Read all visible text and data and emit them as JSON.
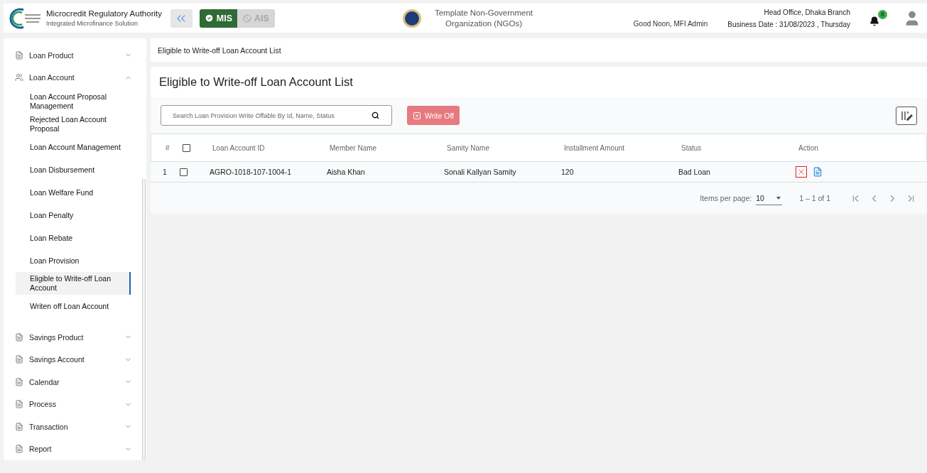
{
  "header": {
    "org_title": "Microcredit Regulatory Authority",
    "org_subtitle": "Integrated Microfinance Solution",
    "modes": [
      {
        "label": "MIS",
        "selected": true
      },
      {
        "label": "AIS",
        "selected": false
      }
    ],
    "center_org": "Template Non-Government Organization (NGOs)",
    "greeting": "Good Noon, MFI Admin",
    "branch": "Head Office, Dhaka Branch",
    "business_date": "Business Date : 31/08/2023 , Thursday",
    "notification_count": "8"
  },
  "sidebar": {
    "items": [
      {
        "label": "Loan Product",
        "kind": "form",
        "expanded": false
      },
      {
        "label": "Loan Account",
        "kind": "people",
        "expanded": true,
        "children": [
          {
            "label": "Loan Account Proposal Management",
            "selected": false
          },
          {
            "label": "Rejected Loan Account Proposal",
            "selected": false
          },
          {
            "label": "Loan Account Management",
            "selected": false
          },
          {
            "label": "Loan Disbursement",
            "selected": false
          },
          {
            "label": "Loan Welfare Fund",
            "selected": false
          },
          {
            "label": "Loan Penalty",
            "selected": false
          },
          {
            "label": "Loan Rebate",
            "selected": false
          },
          {
            "label": "Loan Provision",
            "selected": false
          },
          {
            "label": "Eligible to Write-off Loan Account",
            "selected": true
          },
          {
            "label": "Writen off Loan Account",
            "selected": false
          }
        ]
      },
      {
        "label": "Savings Product",
        "kind": "form",
        "expanded": false
      },
      {
        "label": "Savings Account",
        "kind": "form",
        "expanded": false
      },
      {
        "label": "Calendar",
        "kind": "form",
        "expanded": false
      },
      {
        "label": "Process",
        "kind": "form",
        "expanded": false
      },
      {
        "label": "Transaction",
        "kind": "form",
        "expanded": false
      },
      {
        "label": "Report",
        "kind": "form",
        "expanded": false
      }
    ]
  },
  "breadcrumb": "Eligible to Write-off Loan Account List",
  "page_title": "Eligible to Write-off Loan Account List",
  "search": {
    "placeholder": "Search Loan Provision Write Offable By Id, Name, Status"
  },
  "write_off_button": {
    "label": "Write Off",
    "disabled": true
  },
  "table": {
    "columns": [
      "#",
      "Loan Account ID",
      "Member Name",
      "Samity Name",
      "Installment Amount",
      "Status",
      "Action"
    ],
    "header_checked": false,
    "rows": [
      {
        "index": "1",
        "checked": false,
        "loan_account_id": "AGRO-1018-107-1004-1",
        "member_name": "Aisha Khan",
        "samity_name": "Sonali Kallyan Samity",
        "installment_amount": "120",
        "status": "Bad Loan"
      }
    ]
  },
  "paginator": {
    "items_per_page_label": "Items per page:",
    "items_per_page": "10",
    "range": "1 – 1 of 1"
  }
}
